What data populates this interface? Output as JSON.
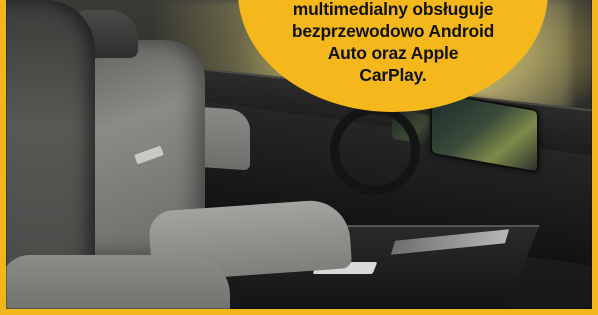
{
  "callout": {
    "lines": [
      "multimedialny obsługuje",
      "bezprzewodowo Android",
      "Auto oraz Apple",
      "CarPlay."
    ]
  },
  "colors": {
    "accent": "#f5b81c",
    "frame": "#f1b61c",
    "text": "#111111"
  }
}
